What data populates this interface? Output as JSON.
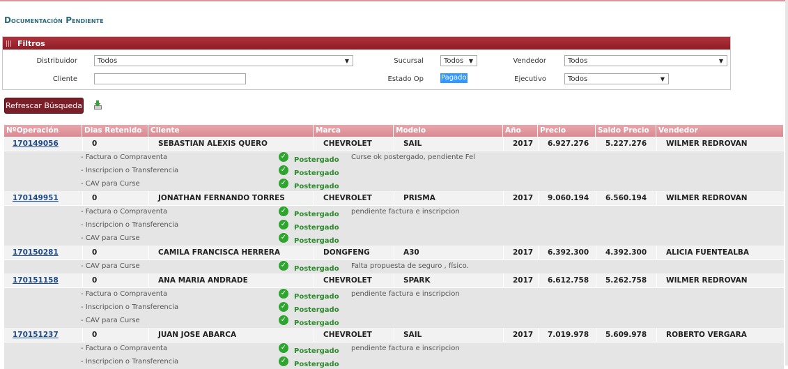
{
  "page": {
    "title": "Documentación Pendiente"
  },
  "filters": {
    "header": "Filtros",
    "distribuidor": {
      "label": "Distribuidor",
      "value": "Todos"
    },
    "cliente": {
      "label": "Cliente",
      "value": ""
    },
    "sucursal": {
      "label": "Sucursal",
      "value": "Todos"
    },
    "estado_op": {
      "label": "Estado Op",
      "value": "Pagado"
    },
    "vendedor": {
      "label": "Vendedor",
      "value": "Todos"
    },
    "ejecutivo": {
      "label": "Ejecutivo",
      "value": "Todos"
    }
  },
  "actions": {
    "refresh_label": "Refrescar Búsqueda",
    "export_icon": "export-excel-icon"
  },
  "table": {
    "columns": [
      "NºOperación",
      "Dias Retenido",
      "Cliente",
      "Marca",
      "Modelo",
      "Año",
      "Precio",
      "Saldo Precio",
      "Vendedor"
    ],
    "rows": [
      {
        "operacion": "170149056",
        "dias": "0",
        "cliente": "SEBASTIAN ALEXIS QUERO",
        "marca": "CHEVROLET",
        "modelo": "SAIL",
        "anio": "2017",
        "precio": "6.927.276",
        "saldo": "5.227.276",
        "vendedor": "WILMER REDROVAN",
        "observacion": "Curse ok postergado, pendiente Fel",
        "details": [
          {
            "item": "-  Factura o Compraventa",
            "status": "Postergado"
          },
          {
            "item": "-  Inscripcion o Transferencia",
            "status": "Postergado"
          },
          {
            "item": "-  CAV para Curse",
            "status": "Postergado"
          }
        ]
      },
      {
        "operacion": "170149951",
        "dias": "0",
        "cliente": "JONATHAN FERNANDO TORRES",
        "marca": "CHEVROLET",
        "modelo": "PRISMA",
        "anio": "2017",
        "precio": "9.060.194",
        "saldo": "6.560.194",
        "vendedor": "WILMER REDROVAN",
        "observacion": "pendiente factura e inscripcion",
        "details": [
          {
            "item": "-  Factura o Compraventa",
            "status": "Postergado"
          },
          {
            "item": "-  Inscripcion o Transferencia",
            "status": "Postergado"
          },
          {
            "item": "-  CAV para Curse",
            "status": "Postergado"
          }
        ]
      },
      {
        "operacion": "170150281",
        "dias": "0",
        "cliente": "CAMILA FRANCISCA HERRERA",
        "marca": "DONGFENG",
        "modelo": "A30",
        "anio": "2017",
        "precio": "6.392.300",
        "saldo": "4.392.300",
        "vendedor": "ALICIA FUENTEALBA",
        "observacion": "Falta propuesta de seguro , físico.",
        "details": [
          {
            "item": "-  CAV para Curse",
            "status": "Postergado"
          }
        ]
      },
      {
        "operacion": "170151158",
        "dias": "0",
        "cliente": "ANA MARIA ANDRADE",
        "marca": "CHEVROLET",
        "modelo": "SPARK",
        "anio": "2017",
        "precio": "6.612.758",
        "saldo": "5.262.758",
        "vendedor": "WILMER REDROVAN",
        "observacion": "pendiente factura e inscripcion",
        "details": [
          {
            "item": "-  Factura o Compraventa",
            "status": "Postergado"
          },
          {
            "item": "-  Inscripcion o Transferencia",
            "status": "Postergado"
          },
          {
            "item": "-  CAV para Curse",
            "status": "Postergado"
          }
        ]
      },
      {
        "operacion": "170151237",
        "dias": "0",
        "cliente": "JUAN JOSE ABARCA",
        "marca": "CHEVROLET",
        "modelo": "SAIL",
        "anio": "2017",
        "precio": "7.019.978",
        "saldo": "5.609.978",
        "vendedor": "ROBERTO VERGARA",
        "observacion": "pendiente factura e inscripcion",
        "details": [
          {
            "item": "-  Factura o Compraventa",
            "status": "Postergado"
          },
          {
            "item": "-  Inscripcion o Transferencia",
            "status": "Postergado"
          }
        ]
      }
    ]
  }
}
